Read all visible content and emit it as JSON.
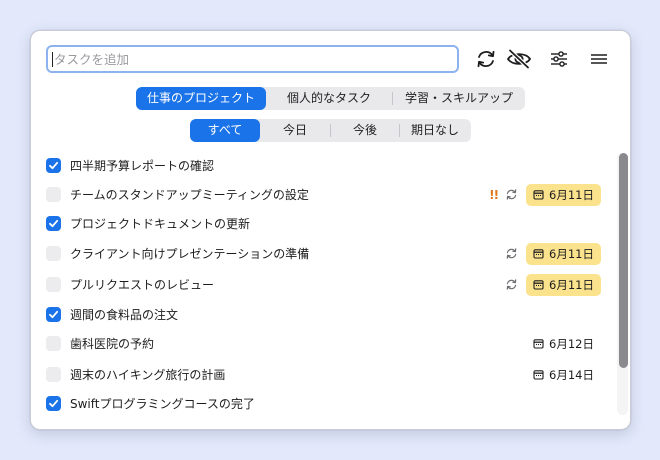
{
  "search": {
    "placeholder": "タスクを追加",
    "value": ""
  },
  "toolbar": {
    "sync_icon": "sync-icon",
    "hide_icon": "eye-slash-icon",
    "filter_icon": "sliders-icon",
    "menu_icon": "hamburger-menu-icon"
  },
  "projects": [
    {
      "label": "仕事のプロジェクト",
      "active": true
    },
    {
      "label": "個人的なタスク",
      "active": false
    },
    {
      "label": "学習・スキルアップ",
      "active": false
    }
  ],
  "filters": [
    {
      "label": "すべて",
      "active": true
    },
    {
      "label": "今日",
      "active": false
    },
    {
      "label": "今後",
      "active": false
    },
    {
      "label": "期日なし",
      "active": false
    }
  ],
  "tasks": [
    {
      "title": "四半期予算レポートの確認",
      "done": true,
      "priority": "",
      "repeat": false,
      "due": "",
      "highlight": false
    },
    {
      "title": "チームのスタンドアップミーティングの設定",
      "done": false,
      "priority": "!!",
      "repeat": true,
      "due": "6月11日",
      "highlight": true
    },
    {
      "title": "プロジェクトドキュメントの更新",
      "done": true,
      "priority": "",
      "repeat": false,
      "due": "",
      "highlight": false
    },
    {
      "title": "クライアント向けプレゼンテーションの準備",
      "done": false,
      "priority": "",
      "repeat": true,
      "due": "6月11日",
      "highlight": true
    },
    {
      "title": "プルリクエストのレビュー",
      "done": false,
      "priority": "",
      "repeat": true,
      "due": "6月11日",
      "highlight": true
    },
    {
      "title": "週間の食料品の注文",
      "done": true,
      "priority": "",
      "repeat": false,
      "due": "",
      "highlight": false
    },
    {
      "title": "歯科医院の予約",
      "done": false,
      "priority": "",
      "repeat": false,
      "due": "6月12日",
      "highlight": false
    },
    {
      "title": "週末のハイキング旅行の計画",
      "done": false,
      "priority": "",
      "repeat": false,
      "due": "6月14日",
      "highlight": false
    },
    {
      "title": "Swiftプログラミングコースの完了",
      "done": true,
      "priority": "",
      "repeat": false,
      "due": "",
      "highlight": false
    }
  ],
  "colors": {
    "accent": "#1a73e8",
    "due_highlight": "#fbe28c",
    "priority": "#e0791c"
  }
}
